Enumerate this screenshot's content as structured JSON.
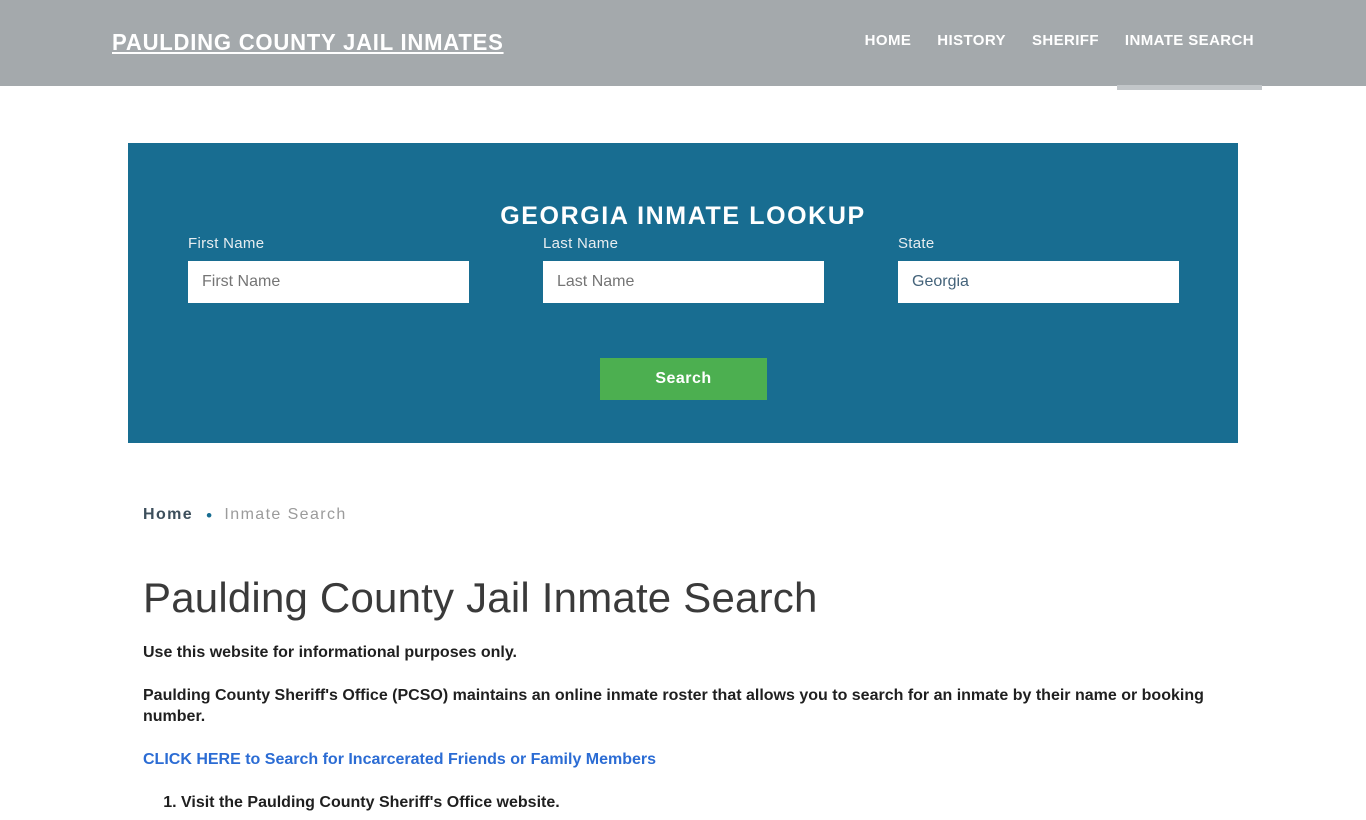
{
  "header": {
    "logo": "PAULDING COUNTY JAIL INMATES",
    "nav": [
      {
        "label": "HOME",
        "active": false
      },
      {
        "label": "HISTORY",
        "active": false
      },
      {
        "label": "SHERIFF",
        "active": false
      },
      {
        "label": "INMATE SEARCH",
        "active": true
      }
    ],
    "bg_color": "#a4a9ac"
  },
  "search_panel": {
    "title": "GEORGIA INMATE LOOKUP",
    "bg_color": "#186d91",
    "first_name": {
      "label": "First Name",
      "placeholder": "First Name",
      "value": ""
    },
    "last_name": {
      "label": "Last Name",
      "placeholder": "Last Name",
      "value": ""
    },
    "state": {
      "label": "State",
      "value": "Georgia"
    },
    "submit_label": "Search",
    "submit_color": "#4caf50"
  },
  "breadcrumb": {
    "home": "Home",
    "separator": "•",
    "current": "Inmate Search"
  },
  "article": {
    "title": "Paulding County Jail Inmate Search",
    "paragraph_1": "Use this website for informational purposes only.",
    "paragraph_2": "Paulding County Sheriff's Office (PCSO) maintains an online inmate roster that allows you to search for an inmate by their name or booking number.",
    "cta_link": "CLICK HERE to Search for Incarcerated Friends or Family Members",
    "cta_color": "#2b6cd4",
    "steps": [
      "Visit the Paulding County Sheriff's Office website."
    ]
  }
}
